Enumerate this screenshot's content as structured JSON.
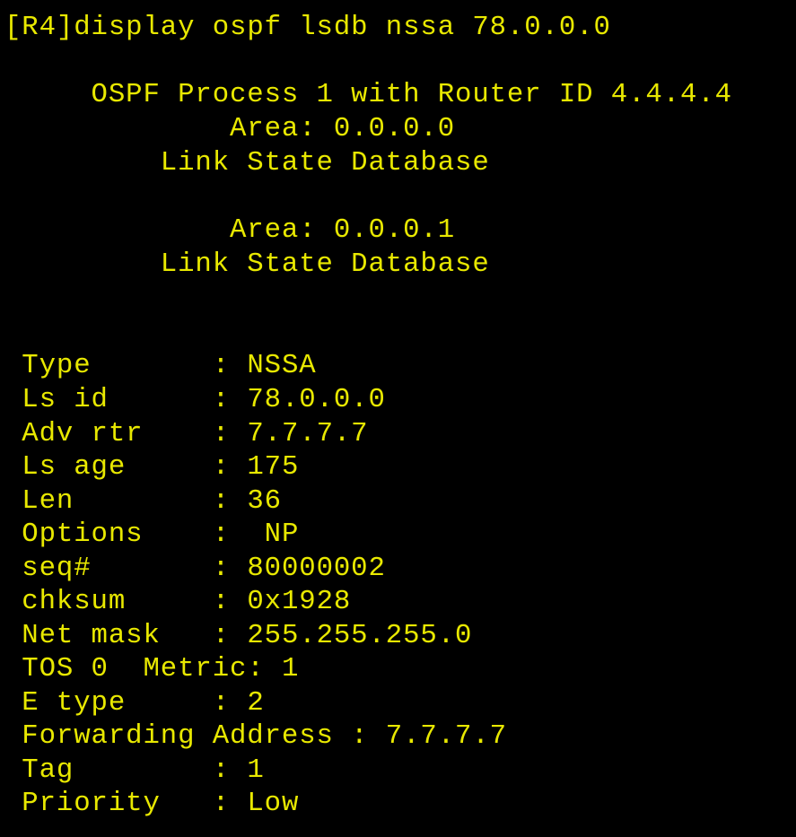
{
  "terminal": {
    "text_color": "#e8e800",
    "background_color": "#000000",
    "prompt": "[R4]",
    "command": "display ospf lsdb nssa 78.0.0.0",
    "header": {
      "process_line": "     OSPF Process 1 with Router ID 4.4.4.4",
      "areas": [
        {
          "area_line": "             Area: 0.0.0.0",
          "db_line": "         Link State Database"
        },
        {
          "area_line": "             Area: 0.0.0.1",
          "db_line": "         Link State Database"
        }
      ]
    },
    "lsa": [
      {
        "label": " Type      ",
        "sep": " : ",
        "value": "NSSA"
      },
      {
        "label": " Ls id     ",
        "sep": " : ",
        "value": "78.0.0.0"
      },
      {
        "label": " Adv rtr   ",
        "sep": " : ",
        "value": "7.7.7.7"
      },
      {
        "label": " Ls age    ",
        "sep": " : ",
        "value": "175"
      },
      {
        "label": " Len       ",
        "sep": " : ",
        "value": "36"
      },
      {
        "label": " Options   ",
        "sep": " :  ",
        "value": "NP"
      },
      {
        "label": " seq#      ",
        "sep": " : ",
        "value": "80000002"
      },
      {
        "label": " chksum    ",
        "sep": " : ",
        "value": "0x1928"
      },
      {
        "label": " Net mask  ",
        "sep": " : ",
        "value": "255.255.255.0"
      },
      {
        "label": " TOS 0  Metric",
        "sep": ": ",
        "value": "1"
      },
      {
        "label": " E type    ",
        "sep": " : ",
        "value": "2"
      },
      {
        "label": " Forwarding Address",
        "sep": " : ",
        "value": "7.7.7.7"
      },
      {
        "label": " Tag       ",
        "sep": " : ",
        "value": "1"
      },
      {
        "label": " Priority  ",
        "sep": " : ",
        "value": "Low"
      }
    ]
  }
}
